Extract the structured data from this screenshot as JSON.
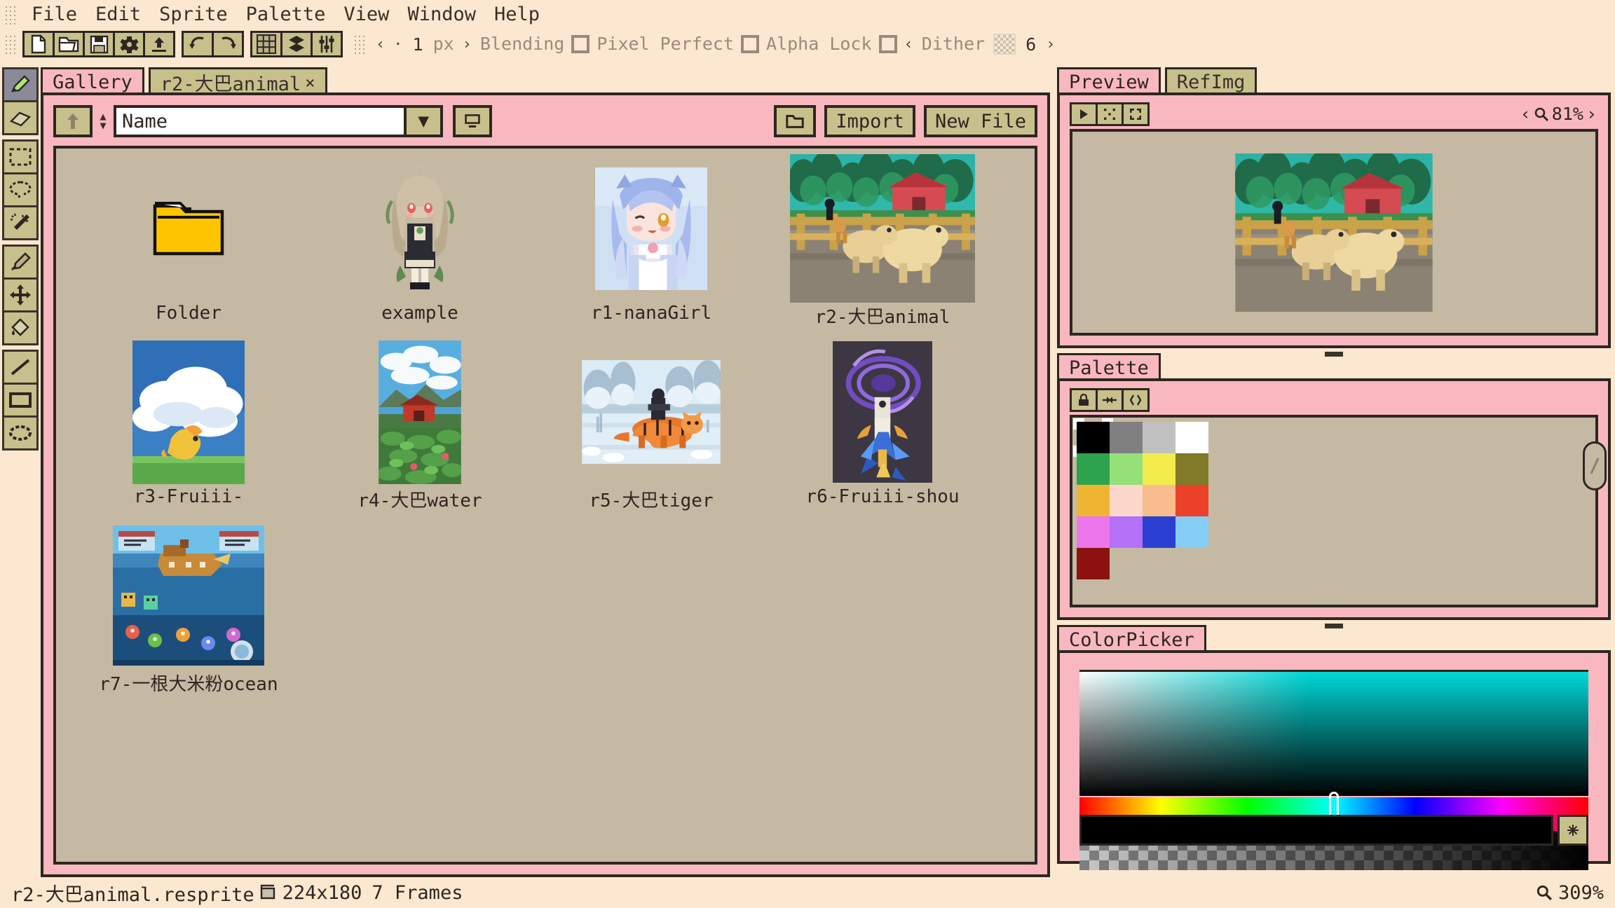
{
  "app": {
    "title": "Aseprite",
    "accent": "#f9b8c0",
    "bg": "#fce8d0",
    "button_bg": "#c8c08c",
    "ink": "#2e2620"
  },
  "menubar": {
    "grip": "drag-grip",
    "items": [
      "File",
      "Edit",
      "Sprite",
      "Palette",
      "View",
      "Window",
      "Help"
    ]
  },
  "toolbar": {
    "buttons": [
      {
        "name": "new-file-icon",
        "label": "New"
      },
      {
        "name": "open-file-icon",
        "label": "Open"
      },
      {
        "name": "save-file-icon",
        "label": "Save"
      },
      {
        "name": "settings-gear-icon",
        "label": "Options"
      },
      {
        "name": "export-upload-icon",
        "label": "Export"
      }
    ],
    "history": [
      {
        "name": "undo-icon",
        "label": "Undo"
      },
      {
        "name": "redo-icon",
        "label": "Redo"
      }
    ],
    "view_toggles": [
      {
        "name": "grid-icon",
        "label": "Grid"
      },
      {
        "name": "layers-icon",
        "label": "Layers"
      },
      {
        "name": "sliders-icon",
        "label": "Adjustments"
      }
    ],
    "brush": {
      "prev_arrow": "‹",
      "dot": "·",
      "size": "1",
      "unit": "px",
      "next_arrow": "›"
    },
    "options": [
      {
        "label": "Blending",
        "checked": false
      },
      {
        "label": "Pixel Perfect",
        "checked": false
      },
      {
        "label": "Alpha Lock",
        "checked": false
      }
    ],
    "dither": {
      "prev_arrow": "‹",
      "label": "Dither",
      "value": "6",
      "next_arrow": "›"
    }
  },
  "tools": [
    {
      "name": "pencil-tool",
      "label": "Pencil",
      "selected": true
    },
    {
      "name": "eraser-tool",
      "label": "Eraser",
      "selected": false
    },
    {
      "name": "rect-select-tool",
      "label": "Rectangular Marquee",
      "selected": false
    },
    {
      "name": "lasso-select-tool",
      "label": "Lasso",
      "selected": false
    },
    {
      "name": "magic-wand-tool",
      "label": "Magic Wand",
      "selected": false
    },
    {
      "name": "eyedropper-tool",
      "label": "Eyedropper",
      "selected": false
    },
    {
      "name": "move-tool",
      "label": "Move",
      "selected": false
    },
    {
      "name": "bucket-fill-tool",
      "label": "Paint Bucket",
      "selected": false
    },
    {
      "name": "line-tool",
      "label": "Line",
      "selected": false
    },
    {
      "name": "rectangle-shape-tool",
      "label": "Rectangle",
      "selected": false
    },
    {
      "name": "ellipse-shape-tool",
      "label": "Ellipse",
      "selected": false
    }
  ],
  "gallery": {
    "tabs": [
      {
        "label": "Gallery",
        "active": true,
        "closable": false
      },
      {
        "label": "r2-大巴animal",
        "active": false,
        "closable": true,
        "close_glyph": "×"
      }
    ],
    "toolbar": {
      "up_button": "up-arrow",
      "sort_field": "Name",
      "sort_placeholder": "Name",
      "dropdown_glyph": "▼",
      "view_mode_button": "list-view",
      "new_folder_button": "new-folder",
      "import_label": "Import",
      "new_file_label": "New File"
    },
    "items": [
      {
        "label": "Folder",
        "kind": "folder"
      },
      {
        "label": "example",
        "kind": "sprite-character"
      },
      {
        "label": "r1-nanaGirl",
        "kind": "sprite-girl"
      },
      {
        "label": "r2-大巴animal",
        "kind": "sprite-animal"
      },
      {
        "label": "r3-Fruiii-",
        "kind": "sprite-clouds"
      },
      {
        "label": "r4-大巴water",
        "kind": "sprite-lake"
      },
      {
        "label": "r5-大巴tiger",
        "kind": "sprite-tiger"
      },
      {
        "label": "r6-Fruiii-shou",
        "kind": "sprite-bird"
      },
      {
        "label": "r7-一根大米粉ocean",
        "kind": "sprite-ocean"
      }
    ]
  },
  "preview": {
    "tabs": [
      {
        "label": "Preview",
        "active": true
      },
      {
        "label": "RefImg",
        "active": false
      }
    ],
    "buttons": [
      {
        "name": "play-icon",
        "label": "Play"
      },
      {
        "name": "onion-skin-icon",
        "label": "Onion Skin"
      },
      {
        "name": "fit-screen-icon",
        "label": "Fit Screen"
      }
    ],
    "zoom": {
      "prev_arrow": "‹",
      "icon": "magnifier-icon",
      "value": "81%",
      "next_arrow": "›"
    }
  },
  "palette": {
    "tab_label": "Palette",
    "buttons": [
      {
        "name": "lock-palette-icon",
        "label": "Lock"
      },
      {
        "name": "sort-palette-icon",
        "label": "Sort"
      },
      {
        "name": "edit-palette-icon",
        "label": "Edit"
      }
    ],
    "selected_index": 0,
    "colors": [
      "#000000",
      "#808080",
      "#c0c0c0",
      "#ffffff",
      "#2ea34e",
      "#96e07a",
      "#f2ec4c",
      "#817a28",
      "#f0b433",
      "#fcd8ca",
      "#f9bc8e",
      "#ec4129",
      "#ec76ec",
      "#b470f7",
      "#2b3fd1",
      "#85cdf2",
      "#8c1212"
    ]
  },
  "colorpicker": {
    "tab_label": "ColorPicker",
    "current_color": "#000000",
    "hue_position_pct": 50,
    "expand_button": "expand-icon"
  },
  "statusbar": {
    "filename": "r2-大巴animal.resprite",
    "size_icon": "canvas-size-icon",
    "dimensions": "224x180",
    "frames": "7 Frames",
    "zoom_icon": "magnifier-icon",
    "zoom": "309%"
  }
}
